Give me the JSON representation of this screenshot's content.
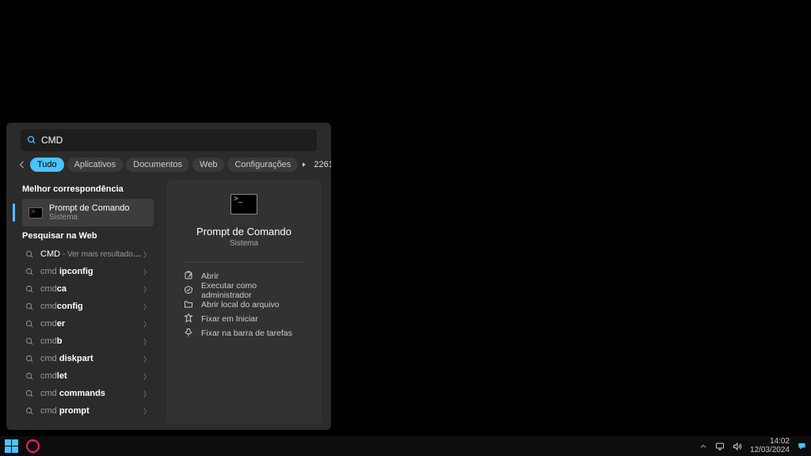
{
  "search": {
    "query": "CMD"
  },
  "filters": {
    "tabs": [
      "Tudo",
      "Aplicativos",
      "Documentos",
      "Web",
      "Configurações"
    ],
    "points": "2261"
  },
  "left": {
    "best_header": "Melhor correspondência",
    "best": {
      "title": "Prompt de Comando",
      "subtitle": "Sistema"
    },
    "web_header": "Pesquisar na Web",
    "rows": [
      {
        "prefix": "CMD",
        "suffix_dim": " - Ver mais resultados da pesquisa"
      },
      {
        "prefix_dim": "cmd ",
        "bold": "ipconfig"
      },
      {
        "prefix_dim": "cmd",
        "bold": "ca"
      },
      {
        "prefix_dim": "cmd",
        "bold": "config"
      },
      {
        "prefix_dim": "cmd",
        "bold": "er"
      },
      {
        "prefix_dim": "cmd",
        "bold": "b"
      },
      {
        "prefix_dim": "cmd ",
        "bold": "diskpart"
      },
      {
        "prefix_dim": "cmd",
        "bold": "let"
      },
      {
        "prefix_dim": "cmd ",
        "bold": "commands"
      },
      {
        "prefix_dim": "cmd ",
        "bold": "prompt"
      }
    ]
  },
  "right": {
    "title": "Prompt de Comando",
    "subtitle": "Sistema",
    "actions": [
      "Abrir",
      "Executar como administrador",
      "Abrir local do arquivo",
      "Fixar em Iniciar",
      "Fixar na barra de tarefas"
    ]
  },
  "taskbar": {
    "time": "14:02",
    "date": "12/03/2024"
  }
}
